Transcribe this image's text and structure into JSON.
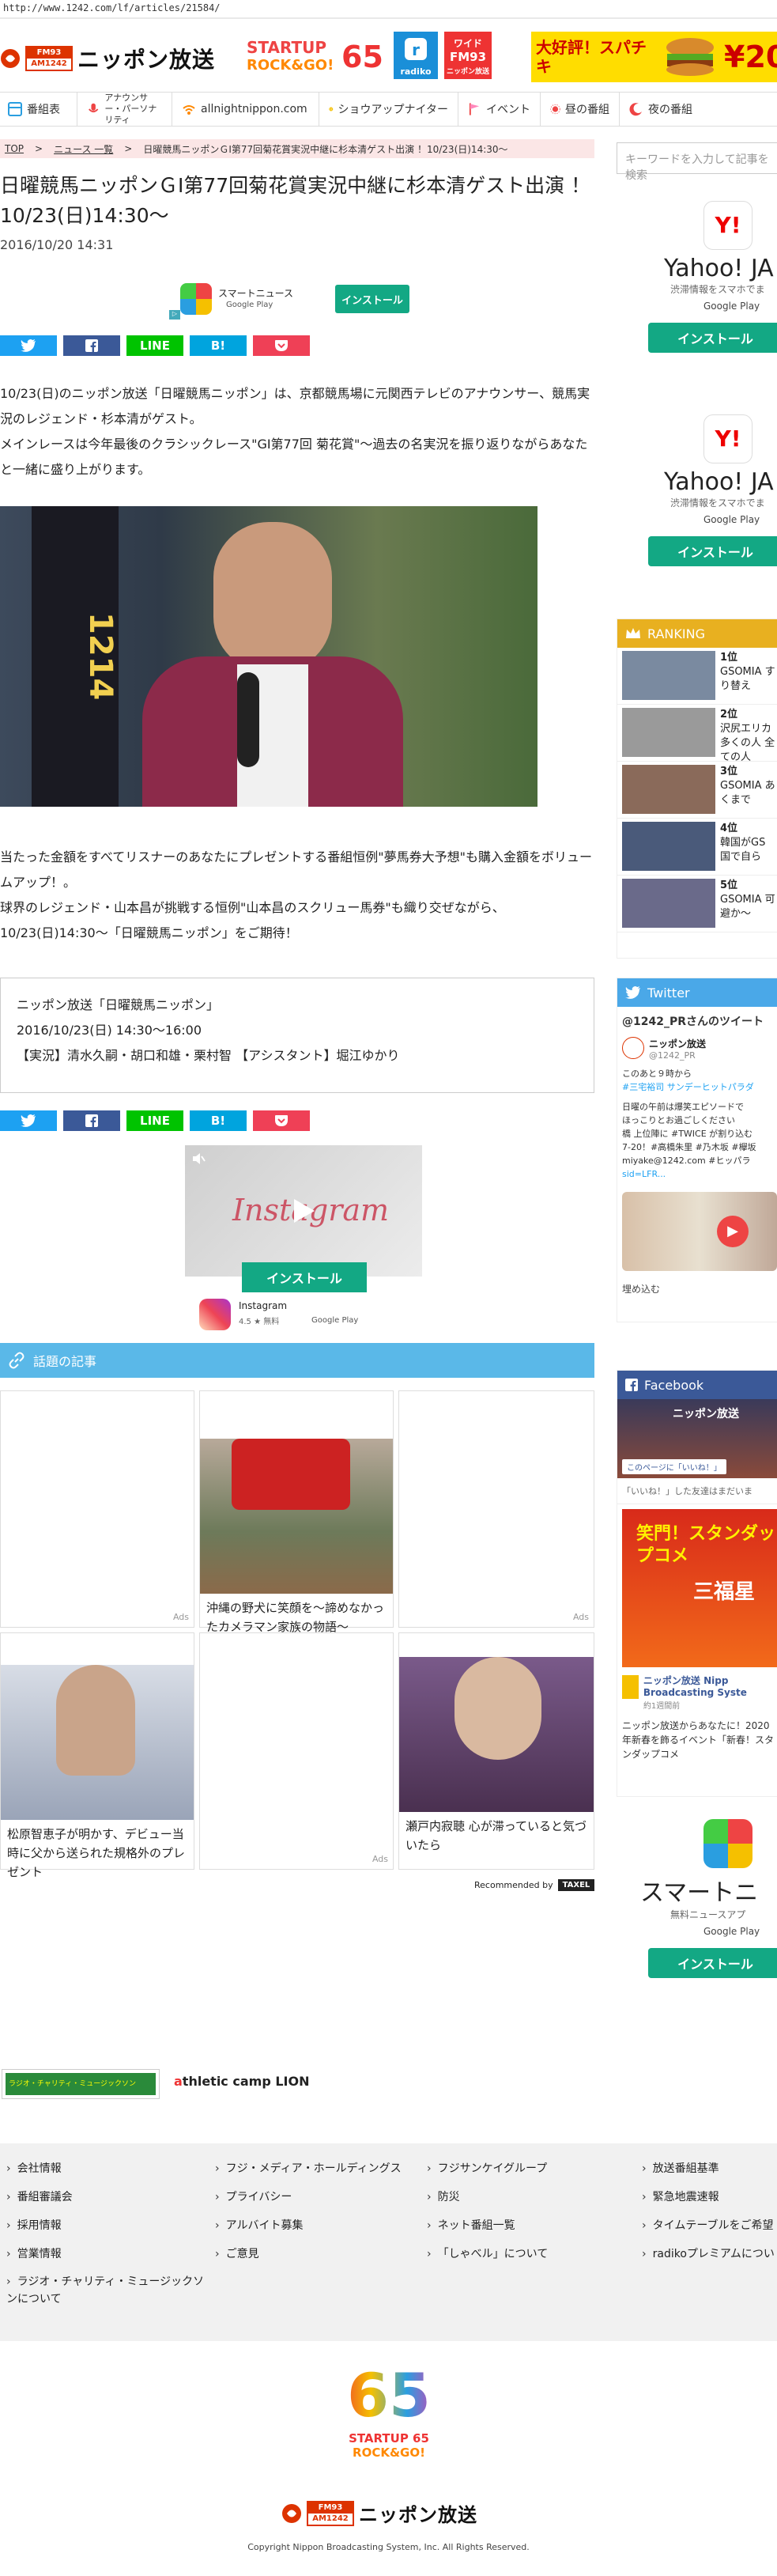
{
  "browser": {
    "url": "http://www.1242.com/lf/articles/21584/"
  },
  "header": {
    "logo_badge_top": "FM93",
    "logo_badge_bottom": "AM1242",
    "logo_name": "ニッポン放送",
    "banner_startup_line1": "STARTUP",
    "banner_startup_line2": "ROCK&GO!",
    "banner_65": "65",
    "radiko_label": "radiko",
    "wide_fm_line1": "ワイド",
    "wide_fm_line2": "FM93",
    "wide_fm_line3": "ニッポン放送",
    "ad_text": "大好評！スパチキ",
    "ad_price": "¥20"
  },
  "nav": {
    "items": [
      {
        "label": "番組表"
      },
      {
        "label": "アナウンサー・パーソナリティ"
      },
      {
        "label": "allnightnippon.com"
      },
      {
        "label": "ショウアップナイター"
      },
      {
        "label": "イベント"
      },
      {
        "label": "昼の番組"
      },
      {
        "label": "夜の番組"
      }
    ]
  },
  "breadcrumb": {
    "top": "TOP",
    "news": "ニュース 一覧",
    "current": "日曜競馬ニッポンＧⅠ第77回菊花賞実況中継に杉本清ゲスト出演 ！10/23(日)14:30～"
  },
  "article": {
    "title": "日曜競馬ニッポンＧⅠ第77回菊花賞実況中継に杉本清ゲスト出演 ！10/23(日)14:30～",
    "date": "2016/10/20 14:31",
    "ad_app_name": "スマートニュース",
    "ad_store": "Google Play",
    "ad_install": "インストール",
    "paragraph1": "10/23(日)のニッポン放送「日曜競馬ニッポン」は、京都競馬場に元関西テレビのアナウンサー、競馬実況のレジェンド・杉本清がゲスト。",
    "paragraph2": "メインレースは今年最後のクラシックレース\"GⅠ第77回 菊花賞\"～過去の名実況を振り返りながらあなたと一緒に盛り上がります。",
    "paragraph3": "当たった金額をすべてリスナーのあなたにプレゼントする番組恒例\"夢馬券大予想\"も購入金額をボリュームアップ！。",
    "paragraph4": "球界のレジェンド・山本昌が挑戦する恒例\"山本昌のスクリュー馬券\"も織り交ぜながら、10/23(日)14:30～「日曜競馬ニッポン」をご期待！",
    "info_line1": "ニッポン放送「日曜競馬ニッポン」",
    "info_line2": "2016/10/23(日) 14:30～16:00",
    "info_line3": "【実況】清水久嗣・胡口和雄・栗村智 【アシスタント】堀江ゆかり"
  },
  "share": {
    "twitter": "",
    "facebook": "",
    "line": "LINE",
    "hatena": "B!",
    "pocket": ""
  },
  "insta_ad": {
    "brand": "Instagram",
    "install": "インストール",
    "name": "Instagram",
    "rating": "4.5 ★ 無料",
    "store": "Google Play"
  },
  "related": {
    "title": "話題の記事",
    "cards": [
      {
        "caption": "",
        "ads": "Ads"
      },
      {
        "caption": "沖縄の野犬に笑顔を～諦めなかったカメラマン家族の物語～",
        "ads": ""
      },
      {
        "caption": "",
        "ads": "Ads"
      },
      {
        "caption": "松原智恵子が明かす、デビュー当時に父から送られた規格外のプレゼント",
        "ads": ""
      },
      {
        "caption": "",
        "ads": "Ads"
      },
      {
        "caption": "瀬戸内寂聴 心が滞っていると気づいたら",
        "ads": ""
      }
    ],
    "recommended": "Recommended by",
    "recommended_brand": "TAXEL"
  },
  "sidebar": {
    "search_placeholder": "キーワードを入力して記事を検索",
    "yahoo_title": "Yahoo! JA",
    "yahoo_sub": "渋滞情報をスマホでま",
    "yahoo_store": "Google Play",
    "yahoo_install": "インストール",
    "ranking_title": "RANKING",
    "ranking": [
      {
        "num": "1位",
        "text": "GSOMIA すり替え"
      },
      {
        "num": "2位",
        "text": "沢尻エリカ 多くの人 全ての人"
      },
      {
        "num": "3位",
        "text": "GSOMIA あくまで"
      },
      {
        "num": "4位",
        "text": "韓国がGS 国で自ら"
      },
      {
        "num": "5位",
        "text": "GSOMIA 可避か～"
      }
    ],
    "twitter_title": "Twitter",
    "twitter_by": "@1242_PRさんのツイート",
    "tw_name": "ニッポン放送",
    "tw_handle": "@1242_PR",
    "tw_text1": "このあと９時から",
    "tw_text2": "#三宅裕司 サンデーヒットパラダ",
    "tw_text3": "日曜の午前は爆笑エピソードで",
    "tw_text4": "ほっこりとお過ごしください",
    "tw_text5": "橋 上位陣に #TWICE が割り込む",
    "tw_text6": "7-20！#高橋朱里 #乃木坂 #欅坂",
    "tw_text7": "miyake@1242.com #ヒッパラ",
    "tw_text8": "sid=LFR...",
    "tw_embed": "埋め込む",
    "fb_title": "Facebook",
    "fb_page": "ニッポン放送",
    "fb_like": "このページに「いいね！」",
    "fb_friends": "「いいね！」した友達はまだいま",
    "fb_banner": "笑門！スタンダップコメ",
    "fb_banner_name": "三福星",
    "fb_post_name": "ニッポン放送 Nipp Broadcasting Syste",
    "fb_post_time": "約1週間前",
    "fb_post_text": "ニッポン放送からあなたに！2020年新春を飾るイベント「新春！スタンダップコメ",
    "smart_title": "スマートニ",
    "smart_sub": "無料ニュースアプ",
    "smart_store": "Google Play",
    "smart_install": "インストール"
  },
  "partners": {
    "charity": "ラジオ・チャリティ・ミュージックソン",
    "athletic_a": "a",
    "athletic": "thletic camp LION"
  },
  "footer": {
    "col1": [
      "会社情報",
      "番組審議会",
      "採用情報",
      "営業情報",
      "ラジオ・チャリティ・ミュージックソンについて"
    ],
    "col2": [
      "フジ・メディア・ホールディングス",
      "プライバシー",
      "アルバイト募集",
      "ご意見"
    ],
    "col3": [
      "フジサンケイグループ",
      "防災",
      "ネット番組一覧",
      "「しゃべル」について"
    ],
    "col4": [
      "放送番組基準",
      "緊急地震速報",
      "タイムテーブルをご希望",
      "radikoプレミアムについ"
    ],
    "anniv_num": "65",
    "anniv_line1": "STARTUP 65",
    "anniv_line2": "ROCK&GO!",
    "logo_badge_top": "FM93",
    "logo_badge_bottom": "AM1242",
    "logo_name": "ニッポン放送",
    "copyright": "Copyright Nippon Broadcasting System, Inc. All Rights Reserved."
  },
  "colors": {
    "twitter": "#1da1f2",
    "facebook": "#3b5998",
    "line": "#00c300",
    "hatena": "#00a4de",
    "pocket": "#ef4056",
    "accent_red": "#dd3300",
    "install_green": "#13a884",
    "section_blue": "#5ab8e8",
    "ranking_gold": "#e8b020",
    "fb_blue": "#3b5998"
  }
}
